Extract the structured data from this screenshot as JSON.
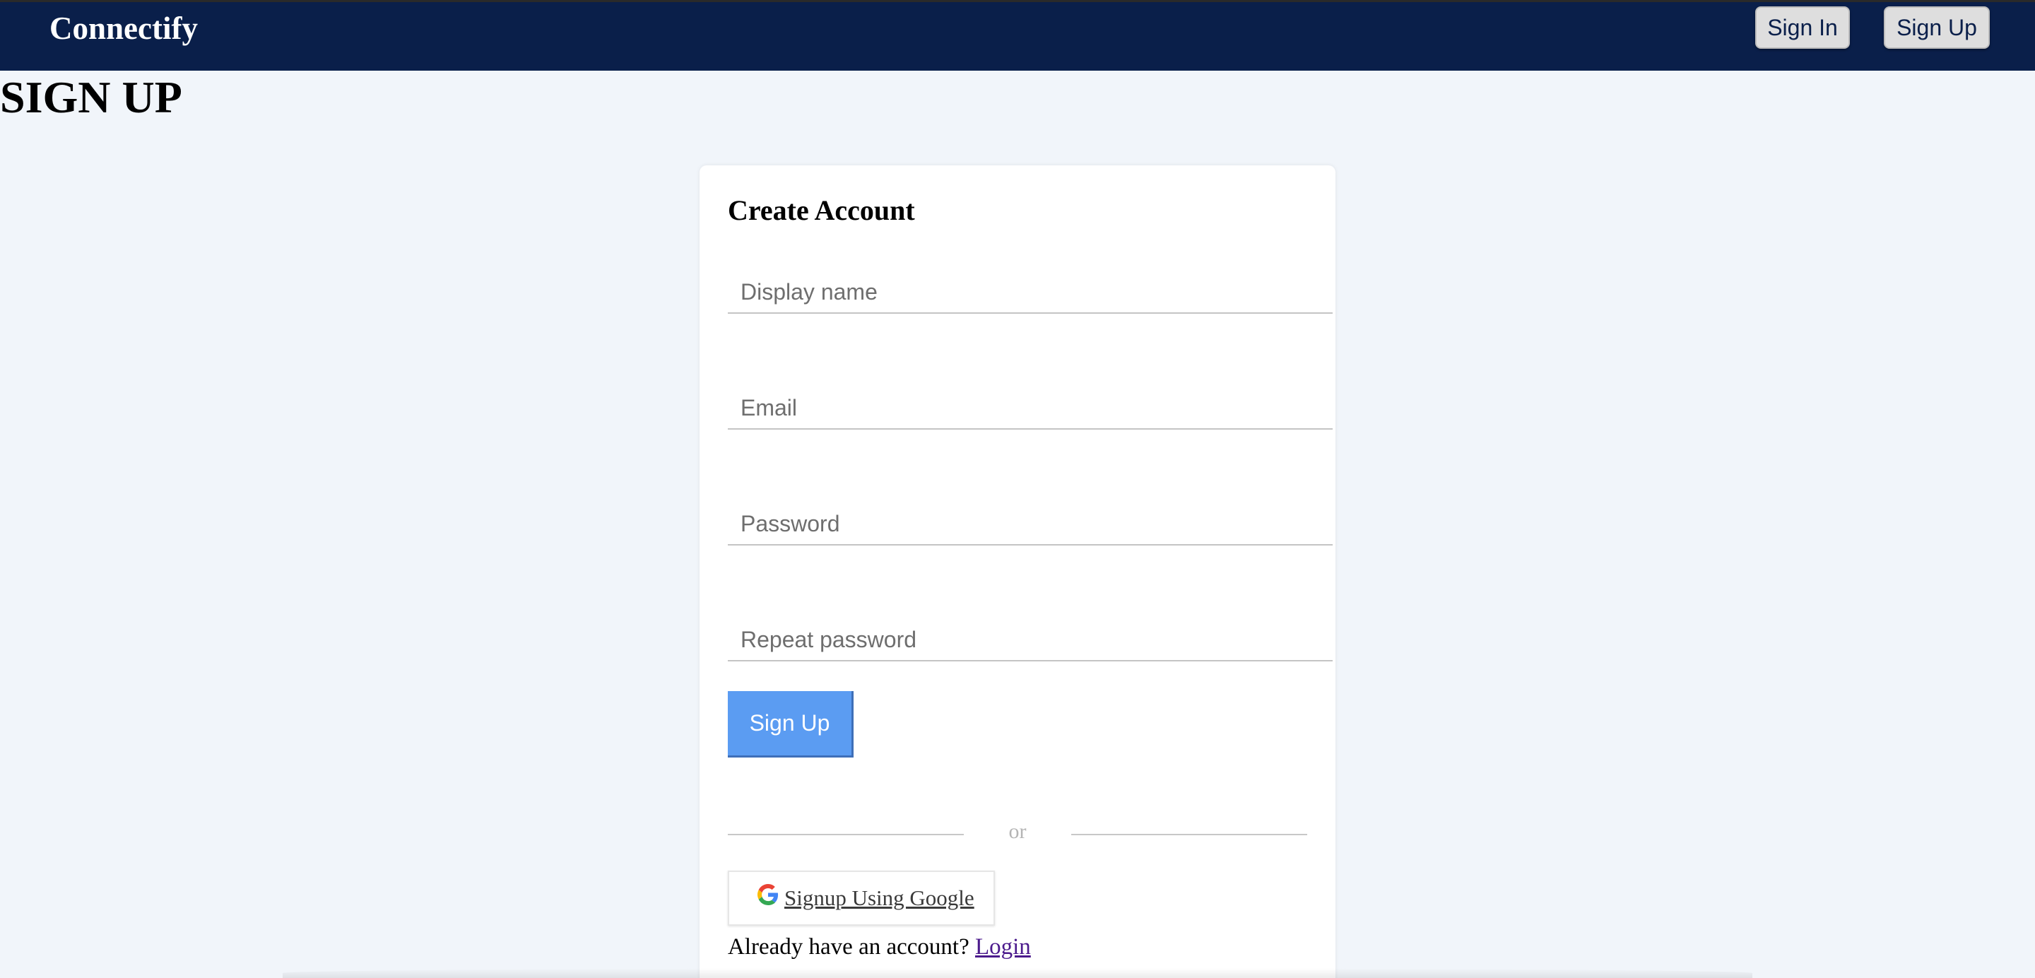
{
  "navbar": {
    "brand": "Connectify",
    "sign_in_label": "Sign In",
    "sign_up_label": "Sign Up"
  },
  "page": {
    "title": "SIGN UP"
  },
  "form": {
    "title": "Create Account",
    "fields": [
      {
        "name": "display-name",
        "placeholder": "Display name",
        "value": ""
      },
      {
        "name": "email",
        "placeholder": "Email",
        "value": ""
      },
      {
        "name": "password",
        "placeholder": "Password",
        "value": ""
      },
      {
        "name": "repeat-password",
        "placeholder": "Repeat password",
        "value": ""
      }
    ],
    "submit_label": "Sign Up",
    "divider_text": "or",
    "google_label": " Signup Using Google",
    "footer_prompt": "Already have an account? ",
    "login_link": "Login"
  },
  "icons": {
    "google": "google-icon"
  },
  "colors": {
    "navbar": "#0a1f4a",
    "accent": "#5b9cf2",
    "background": "#f1f5fa"
  }
}
